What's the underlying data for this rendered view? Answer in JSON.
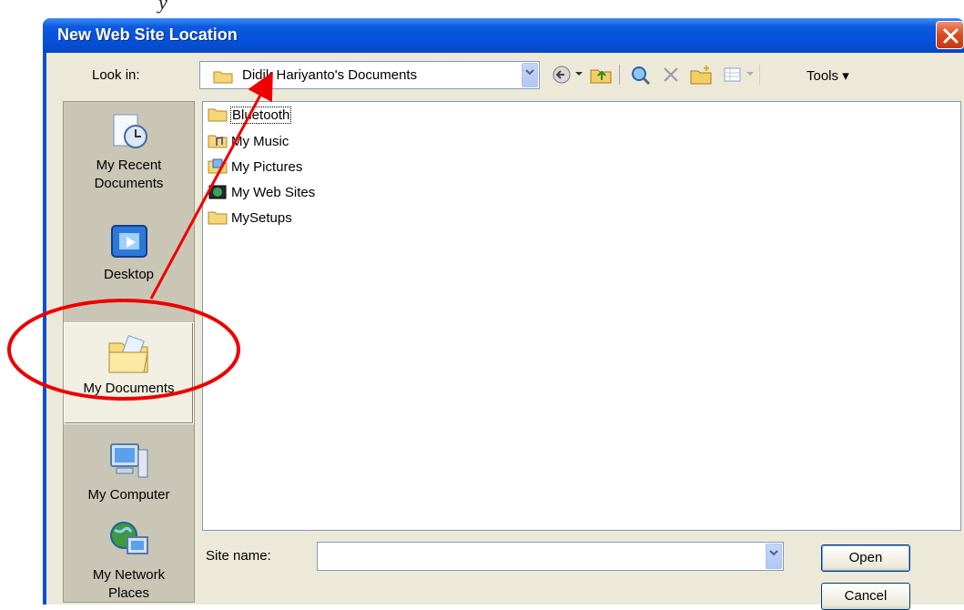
{
  "document_fragment": "y",
  "dialog": {
    "title": "New Web Site Location"
  },
  "look_in": {
    "label": "Look in:",
    "value": "Didik Hariyanto's Documents"
  },
  "toolbar": {
    "icons": [
      "back-icon",
      "up-folder-icon",
      "search-web-icon",
      "delete-icon",
      "new-folder-icon",
      "views-icon"
    ],
    "tools_label": "Tools"
  },
  "places": [
    {
      "label_line1": "My Recent",
      "label_line2": "Documents",
      "icon": "recent-documents-icon"
    },
    {
      "label_line1": "Desktop",
      "label_line2": "",
      "icon": "desktop-icon"
    },
    {
      "label_line1": "My Documents",
      "label_line2": "",
      "icon": "my-documents-icon",
      "selected": true
    },
    {
      "label_line1": "My Computer",
      "label_line2": "",
      "icon": "my-computer-icon"
    },
    {
      "label_line1": "My Network",
      "label_line2": "Places",
      "icon": "network-places-icon"
    }
  ],
  "files": [
    {
      "name": "Bluetooth",
      "icon": "folder-icon"
    },
    {
      "name": "My Music",
      "icon": "music-folder-icon"
    },
    {
      "name": "My Pictures",
      "icon": "pictures-folder-icon"
    },
    {
      "name": "My Web Sites",
      "icon": "web-sites-folder-icon"
    },
    {
      "name": "MySetups",
      "icon": "folder-icon"
    }
  ],
  "site_name": {
    "label": "Site name:",
    "value": ""
  },
  "buttons": {
    "open": "Open",
    "cancel": "Cancel"
  },
  "colors": {
    "title_bar": "#0550d8",
    "dialog_face": "#ece9d8",
    "annotation": "#ee0000"
  }
}
